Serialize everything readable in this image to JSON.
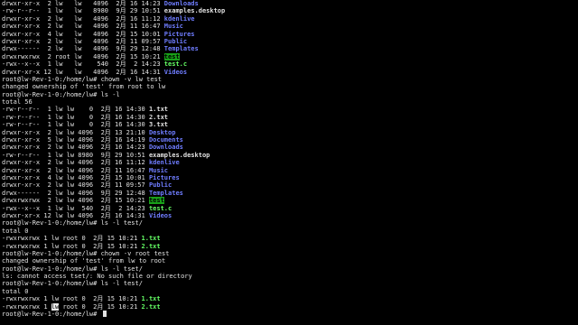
{
  "terminal": {
    "lines": [
      {
        "prefix": "drwxr-xr-x  2 lw   lw   4096  2月 16 14:23 ",
        "name": "Downloads",
        "kind": "dir"
      },
      {
        "prefix": "-rw-r--r--  1 lw   lw   8980  9月 29 10:51 ",
        "name": "examples.desktop",
        "kind": "plain"
      },
      {
        "prefix": "drwxr-xr-x  2 lw   lw   4096  2月 16 11:12 ",
        "name": "kdenlive",
        "kind": "dir"
      },
      {
        "prefix": "drwxr-xr-x  2 lw   lw   4096  2月 11 16:47 ",
        "name": "Music",
        "kind": "dir"
      },
      {
        "prefix": "drwxr-xr-x  4 lw   lw   4096  2月 15 10:01 ",
        "name": "Pictures",
        "kind": "dir"
      },
      {
        "prefix": "drwxr-xr-x  2 lw   lw   4096  2月 11 09:57 ",
        "name": "Public",
        "kind": "dir"
      },
      {
        "prefix": "drwx------  2 lw   lw   4096  9月 29 12:48 ",
        "name": "Templates",
        "kind": "dir"
      },
      {
        "prefix": "drwxrwxrwx  2 root lw   4096  2月 15 10:21 ",
        "name": "test",
        "kind": "hl"
      },
      {
        "prefix": "-rwx--x--x  1 lw   lw    540  2月  2 14:23 ",
        "name": "test.c",
        "kind": "exec"
      },
      {
        "prefix": "drwxr-xr-x 12 lw   lw   4096  2月 16 14:31 ",
        "name": "Videos",
        "kind": "dir"
      },
      {
        "prefix": "root@lw-Rev-1-0:/home/lw# chown -v lw test",
        "name": "",
        "kind": "plain"
      },
      {
        "prefix": "changed ownership of 'test' from root to lw",
        "name": "",
        "kind": "plain"
      },
      {
        "prefix": "root@lw-Rev-1-0:/home/lw# ls -l",
        "name": "",
        "kind": "plain"
      },
      {
        "prefix": "total 56",
        "name": "",
        "kind": "plain"
      },
      {
        "prefix": "-rw-r--r--  1 lw lw    0  2月 16 14:30 ",
        "name": "1.txt",
        "kind": "plain"
      },
      {
        "prefix": "-rw-r--r--  1 lw lw    0  2月 16 14:30 ",
        "name": "2.txt",
        "kind": "plain"
      },
      {
        "prefix": "-rw-r--r--  1 lw lw    0  2月 16 14:30 ",
        "name": "3.txt",
        "kind": "plain"
      },
      {
        "prefix": "drwxr-xr-x  2 lw lw 4096  2月 13 21:10 ",
        "name": "Desktop",
        "kind": "dir"
      },
      {
        "prefix": "drwxr-xr-x  5 lw lw 4096  2月 16 14:19 ",
        "name": "Documents",
        "kind": "dir"
      },
      {
        "prefix": "drwxr-xr-x  2 lw lw 4096  2月 16 14:23 ",
        "name": "Downloads",
        "kind": "dir"
      },
      {
        "prefix": "-rw-r--r--  1 lw lw 8980  9月 29 10:51 ",
        "name": "examples.desktop",
        "kind": "plain"
      },
      {
        "prefix": "drwxr-xr-x  2 lw lw 4096  2月 16 11:12 ",
        "name": "kdenlive",
        "kind": "dir"
      },
      {
        "prefix": "drwxr-xr-x  2 lw lw 4096  2月 11 16:47 ",
        "name": "Music",
        "kind": "dir"
      },
      {
        "prefix": "drwxr-xr-x  4 lw lw 4096  2月 15 10:01 ",
        "name": "Pictures",
        "kind": "dir"
      },
      {
        "prefix": "drwxr-xr-x  2 lw lw 4096  2月 11 09:57 ",
        "name": "Public",
        "kind": "dir"
      },
      {
        "prefix": "drwx------  2 lw lw 4096  9月 29 12:48 ",
        "name": "Templates",
        "kind": "dir"
      },
      {
        "prefix": "drwxrwxrwx  2 lw lw 4096  2月 15 10:21 ",
        "name": "test",
        "kind": "hl"
      },
      {
        "prefix": "-rwx--x--x  1 lw lw  540  2月  2 14:23 ",
        "name": "test.c",
        "kind": "exec"
      },
      {
        "prefix": "drwxr-xr-x 12 lw lw 4096  2月 16 14:31 ",
        "name": "Videos",
        "kind": "dir"
      },
      {
        "prefix": "root@lw-Rev-1-0:/home/lw# ls -l test/",
        "name": "",
        "kind": "plain"
      },
      {
        "prefix": "total 0",
        "name": "",
        "kind": "plain"
      },
      {
        "prefix": "-rwxrwxrwx 1 lw root 0  2月 15 10:21 ",
        "name": "1.txt",
        "kind": "exec"
      },
      {
        "prefix": "-rwxrwxrwx 1 lw root 0  2月 15 10:21 ",
        "name": "2.txt",
        "kind": "exec"
      },
      {
        "prefix": "root@lw-Rev-1-0:/home/lw# chown -v root test",
        "name": "",
        "kind": "plain"
      },
      {
        "prefix": "changed ownership of 'test' from lw to root",
        "name": "",
        "kind": "plain"
      },
      {
        "prefix": "root@lw-Rev-1-0:/home/lw# ls -l tset/",
        "name": "",
        "kind": "plain"
      },
      {
        "prefix": "ls: cannot access tset/: No such file or directory",
        "name": "",
        "kind": "plain"
      },
      {
        "prefix": "root@lw-Rev-1-0:/home/lw# ls -l test/",
        "name": "",
        "kind": "plain"
      },
      {
        "prefix": "total 0",
        "name": "",
        "kind": "plain"
      },
      {
        "prefix": "-rwxrwxrwx 1 lw root 0  2月 15 10:21 ",
        "name": "1.txt",
        "kind": "exec"
      },
      {
        "prefix": "-rwxrwxrwx 1 lw root 0  2月 15 10:21 ",
        "name": "2.txt",
        "kind": "exec"
      },
      {
        "prefix": "root@lw-Rev-1-0:/home/lw# ",
        "name": "",
        "kind": "prompt"
      }
    ]
  }
}
